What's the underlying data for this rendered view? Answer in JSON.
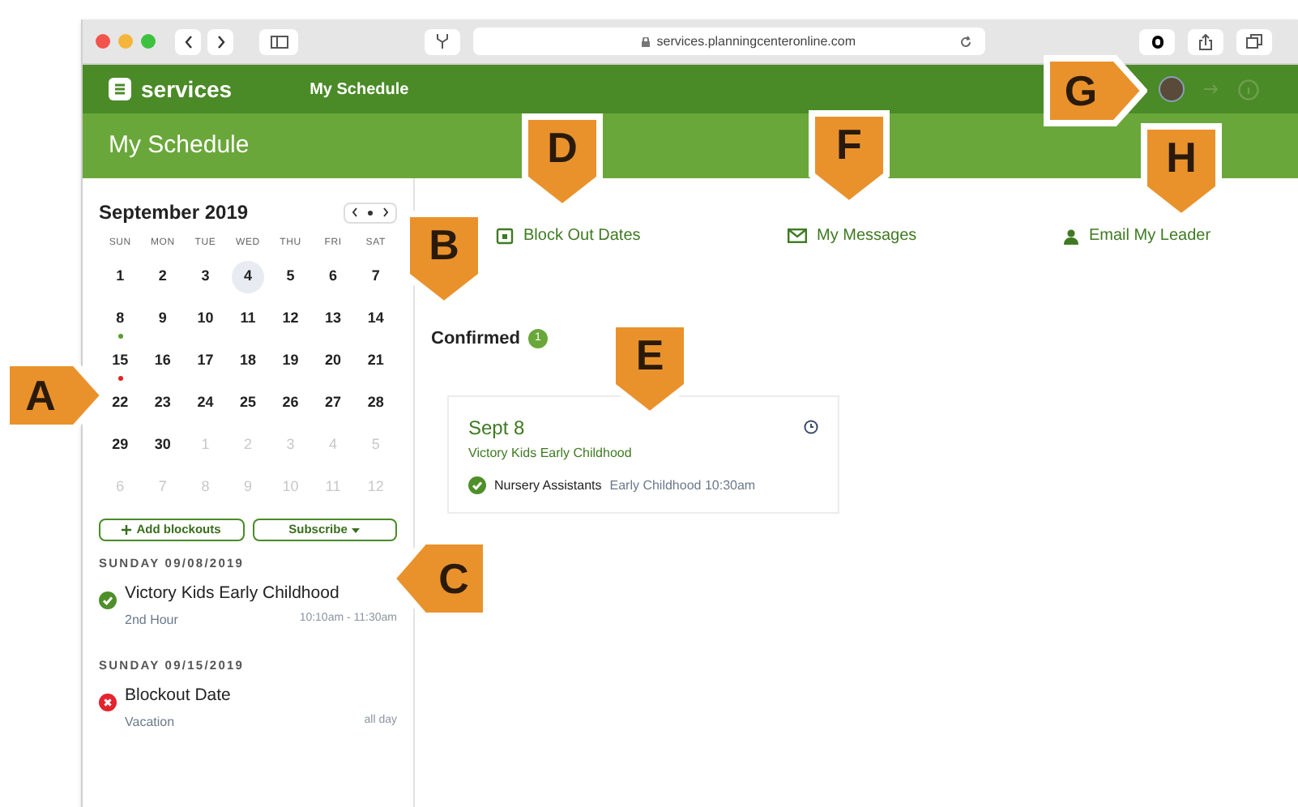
{
  "browser": {
    "url": "services.planningcenteronline.com"
  },
  "nav": {
    "app_name": "services",
    "link": "My Schedule"
  },
  "header": {
    "title": "My Schedule"
  },
  "calendar": {
    "month": "September 2019",
    "weekdays": [
      "SUN",
      "MON",
      "TUE",
      "WED",
      "THU",
      "FRI",
      "SAT"
    ],
    "days": [
      {
        "label": "1",
        "today": false,
        "outside": false
      },
      {
        "label": "2",
        "today": false,
        "outside": false
      },
      {
        "label": "3",
        "today": false,
        "outside": false
      },
      {
        "label": "4",
        "today": true,
        "outside": false
      },
      {
        "label": "5",
        "today": false,
        "outside": false
      },
      {
        "label": "6",
        "today": false,
        "outside": false
      },
      {
        "label": "7",
        "today": false,
        "outside": false
      },
      {
        "label": "8",
        "today": false,
        "outside": false,
        "color": "#5a9e2f"
      },
      {
        "label": "9",
        "today": false,
        "outside": false
      },
      {
        "label": "10",
        "today": false,
        "outside": false
      },
      {
        "label": "11",
        "today": false,
        "outside": false
      },
      {
        "label": "12",
        "today": false,
        "outside": false
      },
      {
        "label": "13",
        "today": false,
        "outside": false
      },
      {
        "label": "14",
        "today": false,
        "outside": false
      },
      {
        "label": "15",
        "today": false,
        "outside": false,
        "color": "#e02424"
      },
      {
        "label": "16",
        "today": false,
        "outside": false
      },
      {
        "label": "17",
        "today": false,
        "outside": false
      },
      {
        "label": "18",
        "today": false,
        "outside": false
      },
      {
        "label": "19",
        "today": false,
        "outside": false
      },
      {
        "label": "20",
        "today": false,
        "outside": false
      },
      {
        "label": "21",
        "today": false,
        "outside": false
      },
      {
        "label": "22",
        "today": false,
        "outside": false
      },
      {
        "label": "23",
        "today": false,
        "outside": false
      },
      {
        "label": "24",
        "today": false,
        "outside": false
      },
      {
        "label": "25",
        "today": false,
        "outside": false
      },
      {
        "label": "26",
        "today": false,
        "outside": false
      },
      {
        "label": "27",
        "today": false,
        "outside": false
      },
      {
        "label": "28",
        "today": false,
        "outside": false
      },
      {
        "label": "29",
        "today": false,
        "outside": false
      },
      {
        "label": "30",
        "today": false,
        "outside": false
      },
      {
        "label": "1",
        "today": false,
        "outside": true
      },
      {
        "label": "2",
        "today": false,
        "outside": true
      },
      {
        "label": "3",
        "today": false,
        "outside": true
      },
      {
        "label": "4",
        "today": false,
        "outside": true
      },
      {
        "label": "5",
        "today": false,
        "outside": true
      },
      {
        "label": "6",
        "today": false,
        "outside": true
      },
      {
        "label": "7",
        "today": false,
        "outside": true
      },
      {
        "label": "8",
        "today": false,
        "outside": true
      },
      {
        "label": "9",
        "today": false,
        "outside": true
      },
      {
        "label": "10",
        "today": false,
        "outside": true
      },
      {
        "label": "11",
        "today": false,
        "outside": true
      },
      {
        "label": "12",
        "today": false,
        "outside": true
      }
    ]
  },
  "sidebar_buttons": [
    {
      "label": "Add blockouts",
      "kind": "add"
    },
    {
      "label": "Subscribe",
      "kind": "dropdown"
    }
  ],
  "events": [
    {
      "date": "SUNDAY 09/08/2019",
      "title": "Victory Kids Early Childhood",
      "subtitle": "2nd Hour",
      "time": "10:10am - 11:30am",
      "kind": "confirmed"
    },
    {
      "date": "SUNDAY 09/15/2019",
      "title": "Blockout Date",
      "subtitle": "Vacation",
      "time": "all day",
      "kind": "blockout"
    }
  ],
  "actions": [
    {
      "label": "Block Out Dates",
      "kind": "calendar"
    },
    {
      "label": "My Messages",
      "kind": "mail"
    },
    {
      "label": "Email My Leader",
      "kind": "person"
    }
  ],
  "confirmed": {
    "label": "Confirmed",
    "count": "1"
  },
  "card": {
    "date": "Sept 8",
    "service": "Victory Kids Early Childhood",
    "position": "Nursery Assistants",
    "team": "Early Childhood 10:30am"
  },
  "callouts": [
    {
      "label": "A",
      "kind": "right"
    },
    {
      "label": "B",
      "kind": "down"
    },
    {
      "label": "C",
      "kind": "left"
    },
    {
      "label": "D",
      "kind": "down"
    },
    {
      "label": "E",
      "kind": "down"
    },
    {
      "label": "F",
      "kind": "down"
    },
    {
      "label": "G",
      "kind": "right"
    },
    {
      "label": "H",
      "kind": "down"
    }
  ]
}
